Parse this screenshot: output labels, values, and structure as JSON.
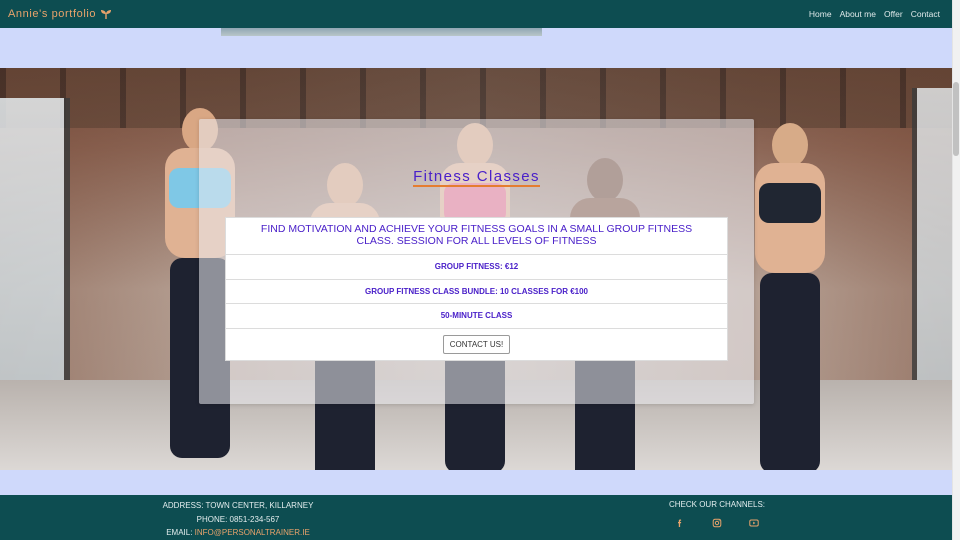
{
  "navbar": {
    "brand": "Annie's portfolio",
    "brand_icon": "sprout-icon",
    "brand_color": "#e9a36b",
    "background": "#0d4d51",
    "links": [
      "Home",
      "About me",
      "Offer",
      "Contact"
    ]
  },
  "hero": {
    "background_image": "group-fitness-class-photo"
  },
  "card": {
    "title": "Fitness Classes",
    "title_color": "#4a20c9",
    "description": "Find motivation and achieve your fitness goals in a small group fitness class. Session for all levels of fitness",
    "items": [
      "Group fitness: €12",
      "Group fitness class bundle: 10 classes for €100",
      "50-minute class"
    ],
    "button_label": "Contact us!"
  },
  "footer": {
    "address": "Address: Town center, Killarney",
    "phone": "Phone: 0851-234-567",
    "email_label": "Email:",
    "email": "info@personaltrainer.ie",
    "channels_label": "Check our channels:",
    "social_icons": [
      "facebook-icon",
      "instagram-icon",
      "youtube-icon"
    ],
    "accent_color": "#e9a36b"
  }
}
